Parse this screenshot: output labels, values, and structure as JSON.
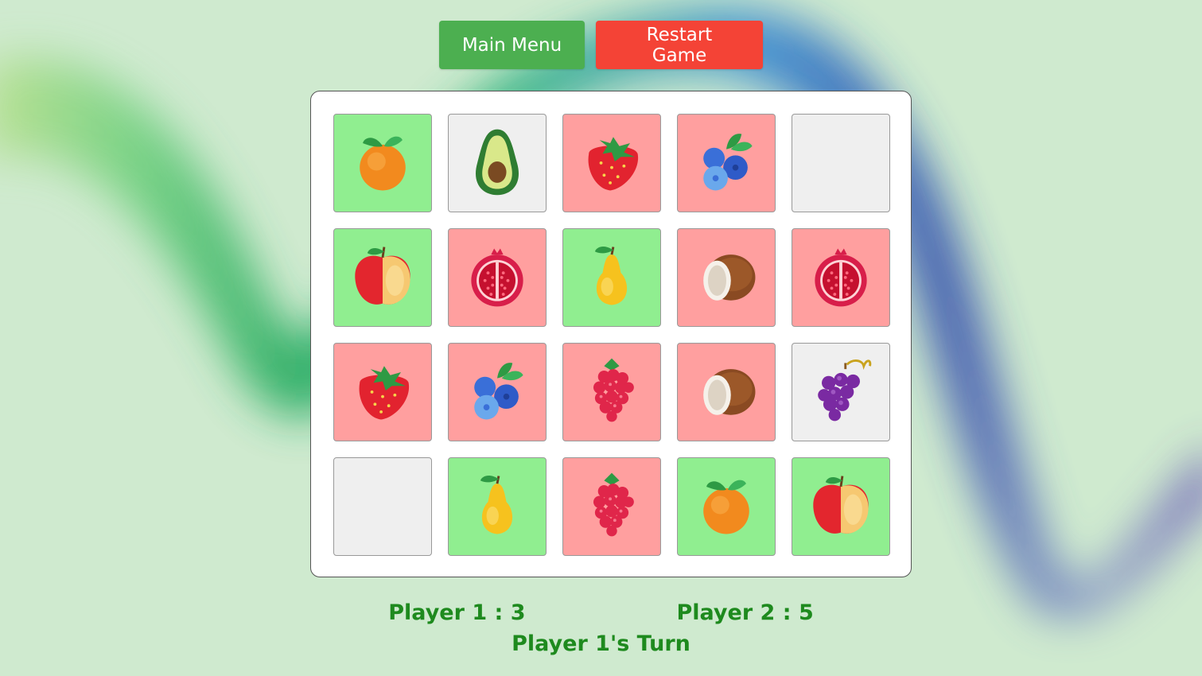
{
  "buttons": {
    "main_menu": "Main Menu",
    "restart": "Restart Game"
  },
  "colors": {
    "matched": "#90ee90",
    "wrong": "#ff9f9f",
    "hidden": "#efefef",
    "menu_button": "#4caf50",
    "restart_button": "#f44336",
    "score_text": "#1e8a1e"
  },
  "board": {
    "rows": [
      [
        {
          "fruit": "orange-icon",
          "state": "matched"
        },
        {
          "fruit": "avocado-icon",
          "state": "open"
        },
        {
          "fruit": "strawberry-icon",
          "state": "wrong"
        },
        {
          "fruit": "blueberries-icon",
          "state": "wrong"
        },
        {
          "fruit": "",
          "state": "hidden"
        }
      ],
      [
        {
          "fruit": "apple-icon",
          "state": "matched"
        },
        {
          "fruit": "pomegranate-icon",
          "state": "wrong"
        },
        {
          "fruit": "pear-icon",
          "state": "matched"
        },
        {
          "fruit": "coconut-icon",
          "state": "wrong"
        },
        {
          "fruit": "pomegranate-icon",
          "state": "wrong"
        }
      ],
      [
        {
          "fruit": "strawberry-icon",
          "state": "wrong"
        },
        {
          "fruit": "blueberries-icon",
          "state": "wrong"
        },
        {
          "fruit": "raspberry-icon",
          "state": "wrong"
        },
        {
          "fruit": "coconut-icon",
          "state": "wrong"
        },
        {
          "fruit": "grapes-icon",
          "state": "open"
        }
      ],
      [
        {
          "fruit": "",
          "state": "hidden"
        },
        {
          "fruit": "pear-icon",
          "state": "matched"
        },
        {
          "fruit": "raspberry-icon",
          "state": "wrong"
        },
        {
          "fruit": "orange-icon",
          "state": "matched"
        },
        {
          "fruit": "apple-icon",
          "state": "matched"
        }
      ]
    ]
  },
  "scores": {
    "player1": "Player 1 : 3",
    "player2": "Player 2 : 5",
    "turn": "Player 1's Turn"
  }
}
